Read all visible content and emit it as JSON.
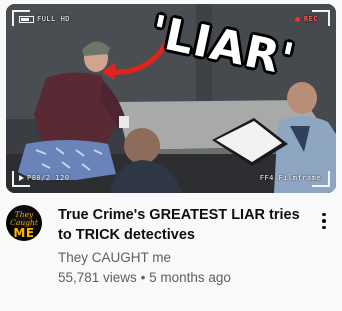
{
  "video": {
    "title": "True Crime's GREATEST LIAR tries to TRICK detectives",
    "channel": "They CAUGHT me",
    "views": "55,781 views",
    "separator": "•",
    "age": "5 months ago"
  },
  "thumbnail": {
    "caption": "'LIAR'",
    "camera_mode": "FULL HD",
    "rec_label": "REC",
    "camera_settings": "P80/2 120",
    "camera_brand": "FF4 Filmframe"
  },
  "avatar": {
    "text_top": "They Caught",
    "text_bottom": "ME"
  },
  "icons": {
    "menu": "more-vert-icon",
    "rec": "rec-dot-icon",
    "battery": "battery-icon",
    "play": "play-icon"
  },
  "colors": {
    "title": "#0f0f0f",
    "secondary_text": "#606060",
    "rec": "#ff2a2a",
    "arrow": "#e0241b",
    "avatar_accent": "#ffb300"
  }
}
